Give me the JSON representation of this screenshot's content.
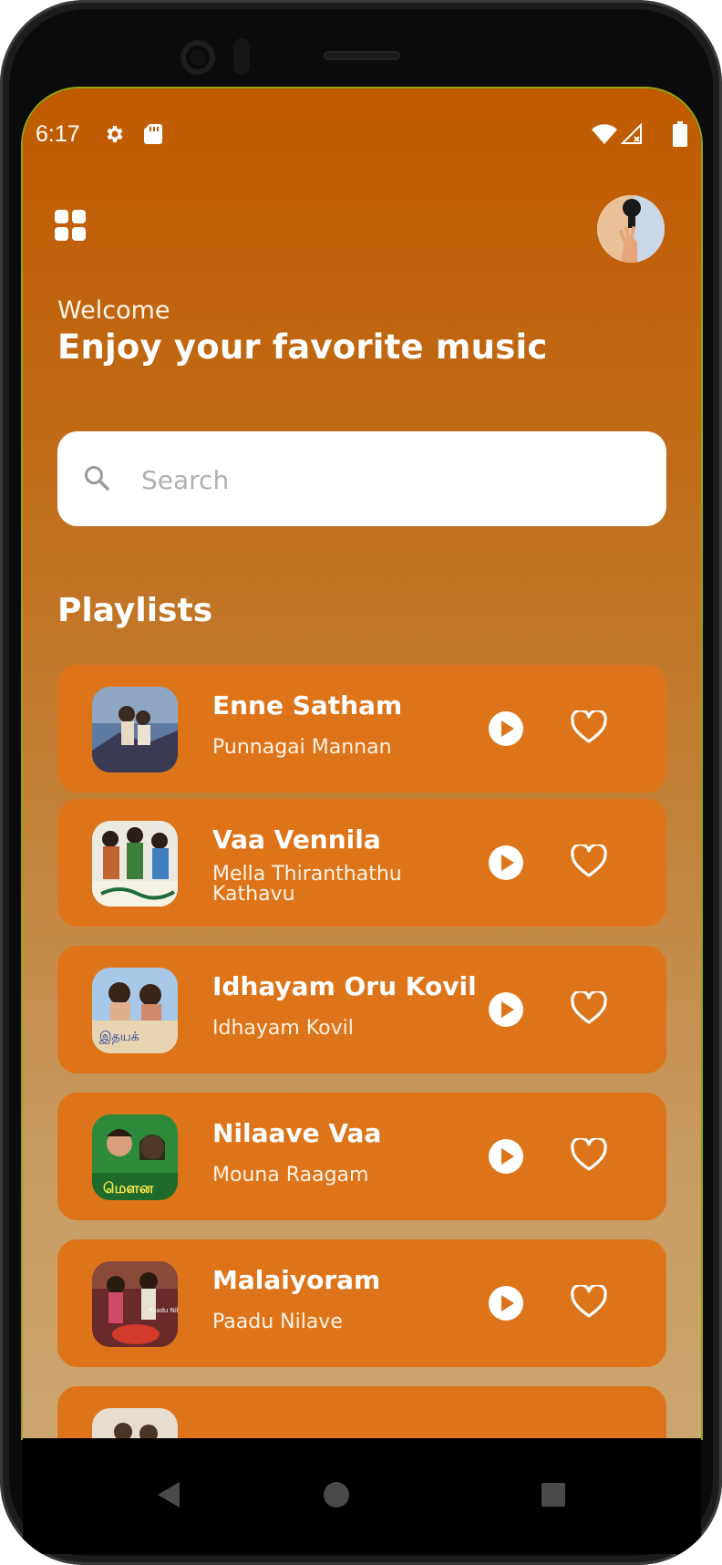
{
  "status": {
    "time": "6:17"
  },
  "header": {
    "welcome": "Welcome",
    "headline": "Enjoy your favorite music"
  },
  "search": {
    "placeholder": "Search",
    "value": ""
  },
  "playlists": {
    "title": "Playlists",
    "items": [
      {
        "title": "Enne Satham",
        "subtitle": "Punnagai Mannan"
      },
      {
        "title": "Vaa Vennila",
        "subtitle": "Mella Thiranthathu Kathavu"
      },
      {
        "title": "Idhayam Oru Kovil",
        "subtitle": "Idhayam Kovil"
      },
      {
        "title": "Nilaave Vaa",
        "subtitle": "Mouna Raagam"
      },
      {
        "title": "Malaiyoram",
        "subtitle": "Paadu Nilave"
      }
    ]
  },
  "colors": {
    "gradient_top": "#c05a00",
    "gradient_bottom": "#cda56f",
    "card": "#de7419",
    "text": "#ffffff"
  },
  "icons": [
    "gear-icon",
    "sd-card-icon",
    "wifi-icon",
    "signal-icon",
    "battery-icon",
    "menu-grid-icon",
    "search-icon",
    "play-icon",
    "heart-icon",
    "back-icon",
    "home-icon",
    "recent-apps-icon"
  ]
}
